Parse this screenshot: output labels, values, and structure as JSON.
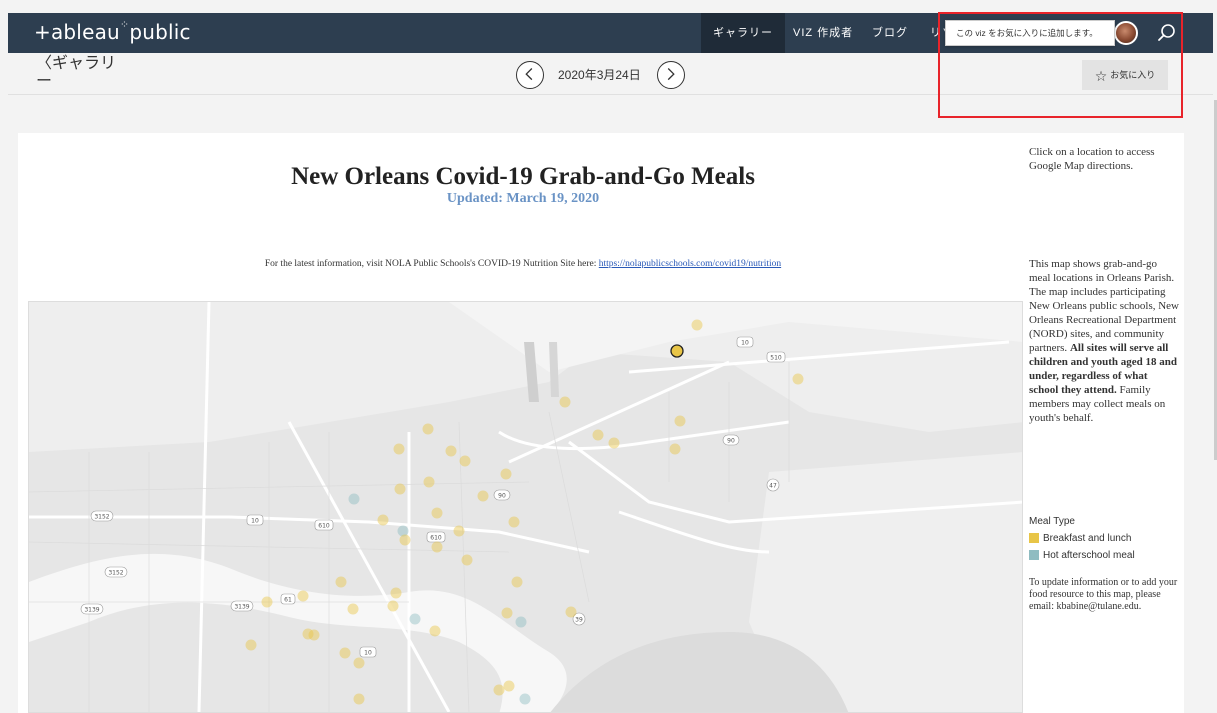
{
  "topnav": {
    "logo": "+ableau",
    "logo_dots": "⁘",
    "logo_suffix": "public",
    "items": [
      {
        "label": "ギャラリー"
      },
      {
        "label": "VIZ 作成者"
      },
      {
        "label": "ブログ"
      },
      {
        "label": "リソ"
      }
    ],
    "tooltip": "この viz をお気に入りに追加します。"
  },
  "subbar": {
    "back": "〈ギャラリー",
    "date": "2020年3月24日",
    "favorite_label": "お気に入り"
  },
  "viz": {
    "title": "New Orleans Covid-19 Grab-and-Go Meals",
    "subtitle": "Updated: March 19, 2020",
    "info_prefix": "For the latest information, visit NOLA Public Schools's COVID-19 Nutrition Site here: ",
    "info_link": "https://nolapublicschools.com/covid19/nutrition",
    "side_directions": "Click on a location to access Google Map directions.",
    "side_desc_1": "This map shows grab-and-go meal locations in Orleans Parish. The map includes participating New Orleans public schools, New Orleans Recreational Department (NORD) sites, and community partners. ",
    "side_desc_bold": "All sites will serve all children and youth aged 18 and under, regardless of what school they attend.",
    "side_desc_2": " Family members may collect meals on youth's behalf.",
    "legend_title": "Meal Type",
    "legend": [
      {
        "label": "Breakfast and lunch",
        "color": "#e8c547"
      },
      {
        "label": "Hot afterschool meal",
        "color": "#8fbcc1"
      }
    ],
    "side_update": "To update information or to add your food resource to this map, please email: kbabine@tulane.edu.",
    "map_shields": [
      "10",
      "510",
      "90",
      "47",
      "3152",
      "10",
      "610",
      "90",
      "610",
      "3152",
      "3139",
      "3139",
      "61",
      "39",
      "10"
    ]
  },
  "colors": {
    "nav_bg": "#2d3e50",
    "breakfast_lunch": "#e8c547",
    "hot_meal": "#8fbcc1",
    "highlight": "#e8232a"
  }
}
